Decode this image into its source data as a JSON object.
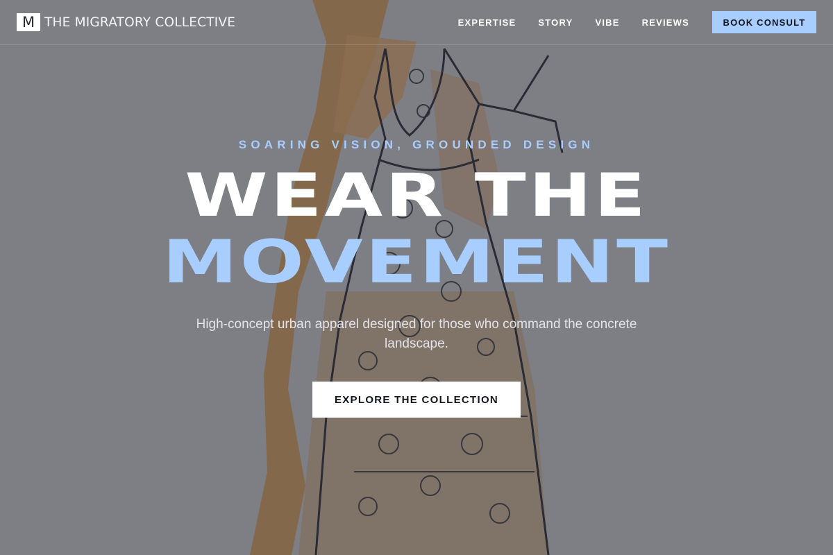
{
  "brand": {
    "logo_letter": "M",
    "name": "THE MIGRATORY COLLECTIVE"
  },
  "nav": {
    "links": [
      "EXPERTISE",
      "STORY",
      "VIBE",
      "REVIEWS"
    ],
    "cta_label": "BOOK CONSULT"
  },
  "hero": {
    "eyebrow": "SOARING VISION, GROUNDED DESIGN",
    "headline_line1": "WEAR THE",
    "headline_line2": "MOVEMENT",
    "subheading": "High-concept urban apparel designed for those who command the concrete landscape.",
    "button_label": "EXPLORE THE COLLECTION",
    "background_image": "fashion-sketch-illustration"
  },
  "colors": {
    "accent": "#a7ceff",
    "overlay": "#3a3c44",
    "text": "#ffffff",
    "button_text": "#12151f"
  }
}
